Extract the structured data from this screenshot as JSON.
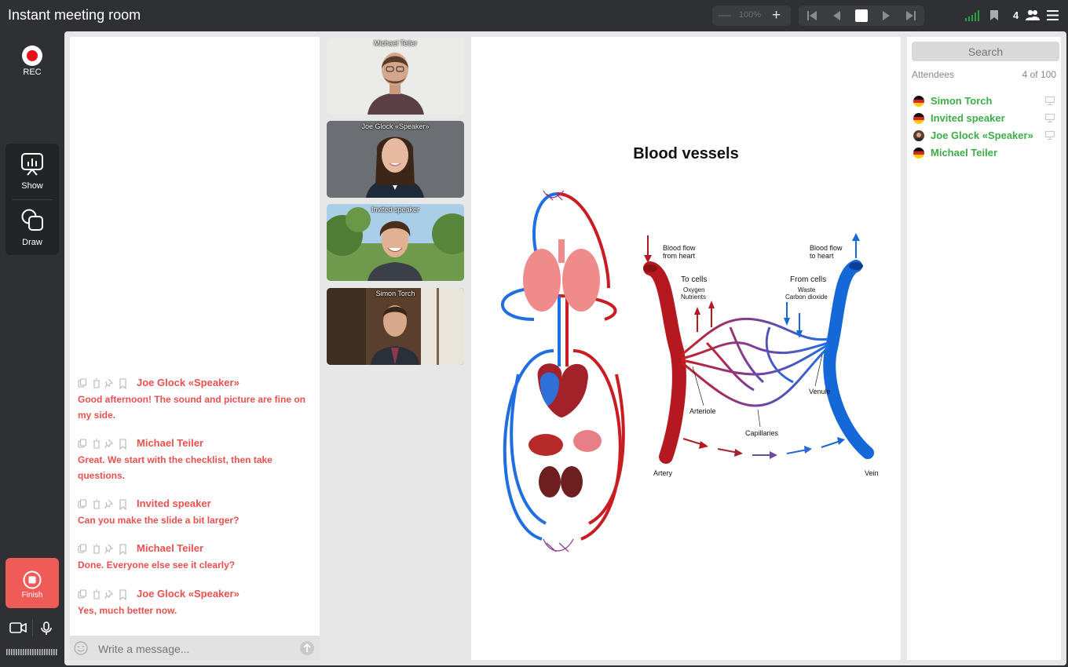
{
  "window": {
    "title": "Instant meeting room"
  },
  "toolbar": {
    "zoom_level": "100%",
    "participant_count": "4",
    "icons": [
      "minus-icon",
      "plus-icon",
      "first-page-icon",
      "prev-page-icon",
      "next-page-icon",
      "last-page-icon",
      "signal-icon",
      "bookmark-icon",
      "users-icon",
      "menu-icon"
    ]
  },
  "left_rail": {
    "rec_label": "REC",
    "show_label": "Show",
    "draw_label": "Draw",
    "finish_label": "Finish"
  },
  "chat": {
    "messages": [
      {
        "author": "Joe Glock «Speaker»",
        "text": "Good afternoon! The sound and picture are fine on my side."
      },
      {
        "author": "Michael Teiler",
        "text": "Great. We start with the checklist, then take questions."
      },
      {
        "author": "Invited speaker",
        "text": "Can you make the slide a bit larger?"
      },
      {
        "author": "Michael Teiler",
        "text": "Done. Everyone else see it clearly?"
      },
      {
        "author": "Joe Glock «Speaker»",
        "text": "Yes, much better now."
      }
    ],
    "input_placeholder": "Write a message..."
  },
  "videos": [
    {
      "name": "Michael Teiler"
    },
    {
      "name": "Joe Glock «Speaker»"
    },
    {
      "name": "Invited speaker"
    },
    {
      "name": "Simon Torch"
    }
  ],
  "slide": {
    "title": "Blood vessels",
    "labels": {
      "flow_from_heart_1": "Blood flow",
      "flow_from_heart_2": "from heart",
      "flow_to_heart_1": "Blood flow",
      "flow_to_heart_2": "to heart",
      "to_cells": "To cells",
      "oxygen": "Oxygen",
      "nutrients": "Nutrients",
      "from_cells": "From cells",
      "waste": "Waste",
      "co2": "Carbon dioxide",
      "arteriole": "Arteriole",
      "capillaries": "Capillaries",
      "venule": "Venule",
      "artery": "Artery",
      "vein": "Vein"
    },
    "colors": {
      "artery": "#c4161c",
      "vein": "#1a73e8"
    }
  },
  "attendees": {
    "search_placeholder": "Search",
    "label": "Attendees",
    "count": "4 of 100",
    "list": [
      {
        "name": "Simon Torch"
      },
      {
        "name": "Invited speaker"
      },
      {
        "name": "Joe Glock «Speaker»"
      },
      {
        "name": "Michael Teiler"
      }
    ]
  },
  "colors": {
    "accent_red": "#ef5b57",
    "author_red": "#e8514f",
    "attendee_green": "#3cad47",
    "bar_bg": "#2f3033"
  }
}
